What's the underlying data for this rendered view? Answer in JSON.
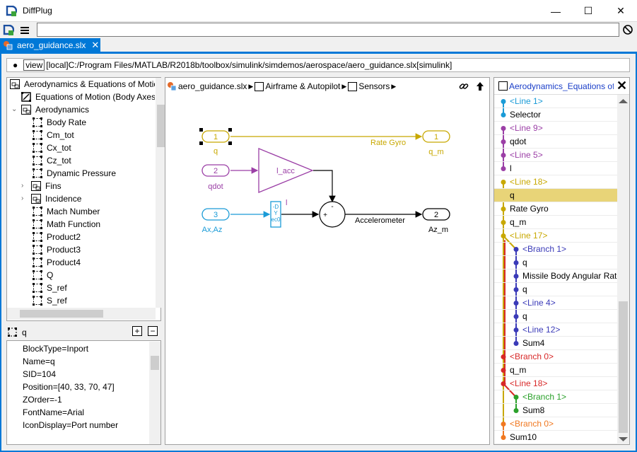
{
  "app": {
    "title": "DiffPlug"
  },
  "window_controls": {
    "minimize": "—",
    "maximize": "☐",
    "close": "✕"
  },
  "toolbar": {
    "command_value": ""
  },
  "tab": {
    "label": "aero_guidance.slx",
    "close": "✕"
  },
  "path": {
    "bullet": "●",
    "view": "view",
    "text": "[local]C:/Program Files/MATLAB/R2018b/toolbox/simulink/simdemos/aerospace/aero_guidance.slx[simulink]"
  },
  "tree": {
    "items": [
      {
        "label": "Aerodynamics & Equations of Motion",
        "kind": "subsystem"
      },
      {
        "label": "Equations of Motion (Body Axes)",
        "kind": "system"
      },
      {
        "label": "Aerodynamics",
        "kind": "subsystem"
      },
      {
        "label": "Body Rate",
        "kind": "block"
      },
      {
        "label": "Cm_tot",
        "kind": "block"
      },
      {
        "label": "Cx_tot",
        "kind": "block"
      },
      {
        "label": "Cz_tot",
        "kind": "block"
      },
      {
        "label": "Dynamic Pressure",
        "kind": "block"
      },
      {
        "label": "Fins",
        "kind": "subsystem"
      },
      {
        "label": "Incidence",
        "kind": "subsystem"
      },
      {
        "label": "Mach  Number",
        "kind": "block"
      },
      {
        "label": "Math Function",
        "kind": "block"
      },
      {
        "label": "Product2",
        "kind": "block"
      },
      {
        "label": "Product3",
        "kind": "block"
      },
      {
        "label": "Product4",
        "kind": "block"
      },
      {
        "label": "Q",
        "kind": "block"
      },
      {
        "label": "S_ref",
        "kind": "block"
      },
      {
        "label": "S_ref",
        "kind": "block"
      }
    ]
  },
  "props": {
    "title": "q",
    "expand": "+",
    "collapse": "−",
    "rows": [
      "BlockType=Inport",
      "Name=q",
      "SID=104",
      "Position=[40, 33, 70, 47]",
      "ZOrder=-1",
      "FontName=Arial",
      "IconDisplay=Port number"
    ]
  },
  "breadcrumbs": [
    "aero_guidance.slx",
    "Airframe & Autopilot",
    "Sensors"
  ],
  "canvas": {
    "inport1_num": "1",
    "inport1_label": "q",
    "inport2_num": "2",
    "inport2_label": "qdot",
    "inport3_num": "3",
    "inport3_label": "Ax,Az",
    "outport1_num": "1",
    "outport1_label": "q_m",
    "outport2_num": "2",
    "outport2_label": "Az_m",
    "rate_gyro": "Rate Gyro",
    "gain_label": "l_acc",
    "sum_minus": "-",
    "sum_plus": "+",
    "accel_label": "Accelerometer",
    "selector_label": "l",
    "selector_text": "-D\nY\nec0"
  },
  "right_panel": {
    "title": "Aerodynamics_Equations of",
    "close": "✕",
    "colors": {
      "blue_light": "#1a9bd7",
      "purple": "#9b3fa6",
      "gold": "#c8a800",
      "navy": "#3a3ab8",
      "red": "#d82828",
      "green": "#2aa02a",
      "orange": "#f07820"
    },
    "rows": [
      {
        "label": "<Line 1>",
        "color": "blue_light",
        "link": true
      },
      {
        "label": "Selector",
        "color": "blue_light",
        "link": false
      },
      {
        "label": "<Line 9>",
        "color": "purple",
        "link": true
      },
      {
        "label": "qdot",
        "color": "purple",
        "link": false
      },
      {
        "label": "<Line 5>",
        "color": "purple",
        "link": true
      },
      {
        "label": "l",
        "color": "purple",
        "link": false
      },
      {
        "label": "<Line 18>",
        "color": "gold",
        "link": true
      },
      {
        "label": "q",
        "color": "gold",
        "link": false,
        "highlight": true
      },
      {
        "label": "Rate Gyro",
        "color": "gold",
        "link": false
      },
      {
        "label": "q_m",
        "color": "gold",
        "link": false
      },
      {
        "label": "<Line 17>",
        "color": "gold",
        "link": true
      },
      {
        "label": "<Branch 1>",
        "color": "navy",
        "link": true
      },
      {
        "label": "q",
        "color": "navy",
        "link": false
      },
      {
        "label": "Missile Body Angular Rates",
        "color": "navy",
        "link": false
      },
      {
        "label": "q",
        "color": "navy",
        "link": false
      },
      {
        "label": "<Line 4>",
        "color": "navy",
        "link": true
      },
      {
        "label": "q",
        "color": "navy",
        "link": false
      },
      {
        "label": "<Line 12>",
        "color": "navy",
        "link": true
      },
      {
        "label": "Sum4",
        "color": "navy",
        "link": false
      },
      {
        "label": "<Branch 0>",
        "color": "red",
        "link": true
      },
      {
        "label": "q_m",
        "color": "red",
        "link": false
      },
      {
        "label": "<Line 18>",
        "color": "red",
        "link": true
      },
      {
        "label": "<Branch 1>",
        "color": "green",
        "link": true
      },
      {
        "label": "Sum8",
        "color": "green",
        "link": false
      },
      {
        "label": "<Branch 0>",
        "color": "orange",
        "link": true
      },
      {
        "label": "Sum10",
        "color": "orange",
        "link": false
      }
    ]
  }
}
